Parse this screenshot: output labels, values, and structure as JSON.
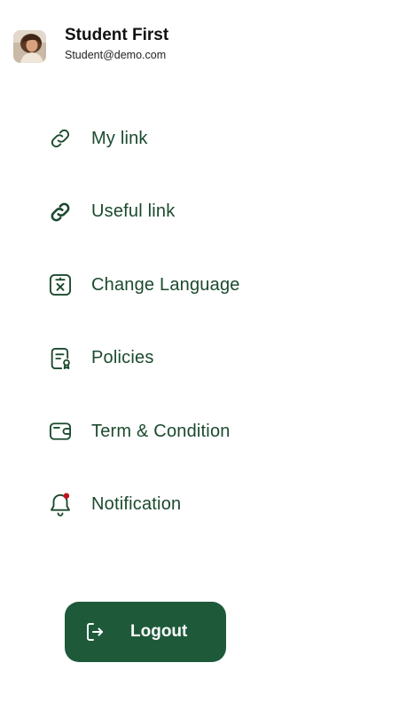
{
  "profile": {
    "name": "Student First",
    "email": "Student@demo.com",
    "avatar_icon": "user-avatar"
  },
  "menu": {
    "items": [
      {
        "label": "My link",
        "icon": "link-icon"
      },
      {
        "label": "Useful link",
        "icon": "link-icon"
      },
      {
        "label": "Change Language",
        "icon": "translate-icon"
      },
      {
        "label": "Policies",
        "icon": "policy-document-icon"
      },
      {
        "label": "Term & Condition",
        "icon": "wallet-card-icon"
      },
      {
        "label": "Notification",
        "icon": "bell-icon"
      }
    ]
  },
  "logout": {
    "label": "Logout",
    "icon": "logout-icon"
  },
  "colors": {
    "accent": "#1e5a3a",
    "menu_text": "#1b4a2e",
    "notification_dot": "#c0121b"
  }
}
